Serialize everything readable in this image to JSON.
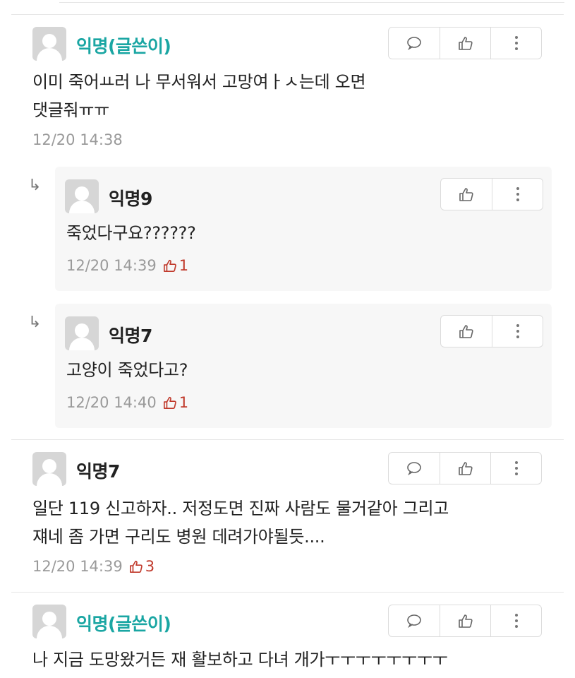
{
  "comments": [
    {
      "author": "익명(글쓴이)",
      "body_line1": "이미 죽어ㅛ러 나 무서워서 고망여ㅏㅅ는데 오면",
      "body_line2": "댓글줘ㅠㅠ",
      "time": "12/20 14:38"
    },
    {
      "author": "익명9",
      "body": "죽었다구요??????",
      "time": "12/20 14:39",
      "likes": "1",
      "reply_arrow": "↳"
    },
    {
      "author": "익명7",
      "body": "고양이 죽었다고?",
      "time": "12/20 14:40",
      "likes": "1",
      "reply_arrow": "↳"
    },
    {
      "author": "익명7",
      "body_line1": "일단 119 신고하자.. 저정도면 진짜 사람도 물거같아 그리고",
      "body_line2": "쟤네 좀 가면 구리도 병원 데려가야될듯....",
      "time": "12/20 14:39",
      "likes": "3"
    },
    {
      "author": "익명(글쓴이)",
      "body": "나 지금 도망왔거든 재 활보하고 다녀 개가ㅜㅜㅜㅜㅜㅜㅜㅜ"
    }
  ],
  "icons": {
    "comment": "speech-bubble-icon",
    "like": "thumbs-up-icon",
    "more": "vertical-dots-icon"
  },
  "colors": {
    "op_author": "#1aa6a3",
    "likes": "#c0392b",
    "meta": "#9a9a9a"
  }
}
